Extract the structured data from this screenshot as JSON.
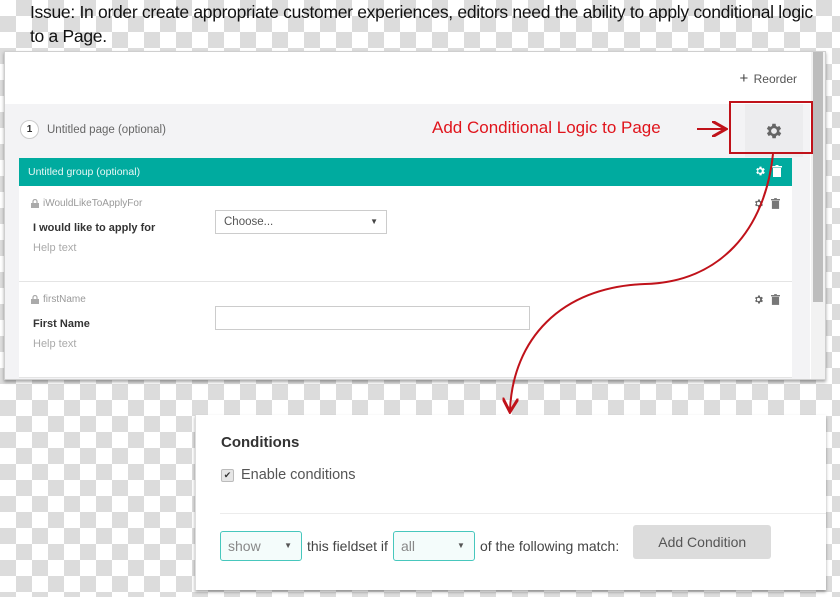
{
  "issue_text": "Issue: In order create appropriate customer experiences, editors need the ability to apply conditional logic to a Page.",
  "editor": {
    "reorder_label": "Reorder",
    "page": {
      "number": "1",
      "title": "Untitled page (optional)"
    },
    "group": {
      "title": "Untitled group (optional)"
    },
    "fields": [
      {
        "key": "iWouldLikeToApplyFor",
        "label": "I would like to apply for",
        "help": "Help text",
        "type": "select",
        "value": "Choose..."
      },
      {
        "key": "firstName",
        "label": "First Name",
        "help": "Help text",
        "type": "text",
        "value": ""
      }
    ]
  },
  "annotation": {
    "text": "Add Conditional Logic to Page",
    "color": "#e0141c"
  },
  "conditions": {
    "title": "Conditions",
    "enable_label": "Enable conditions",
    "enabled": true,
    "action_value": "show",
    "middle_text": "this fieldset if",
    "match_value": "all",
    "end_text": "of the following match:",
    "add_button": "Add Condition"
  },
  "colors": {
    "teal": "#00ab9f",
    "select_border": "#47c7bd",
    "annotation_red": "#c0121a"
  }
}
